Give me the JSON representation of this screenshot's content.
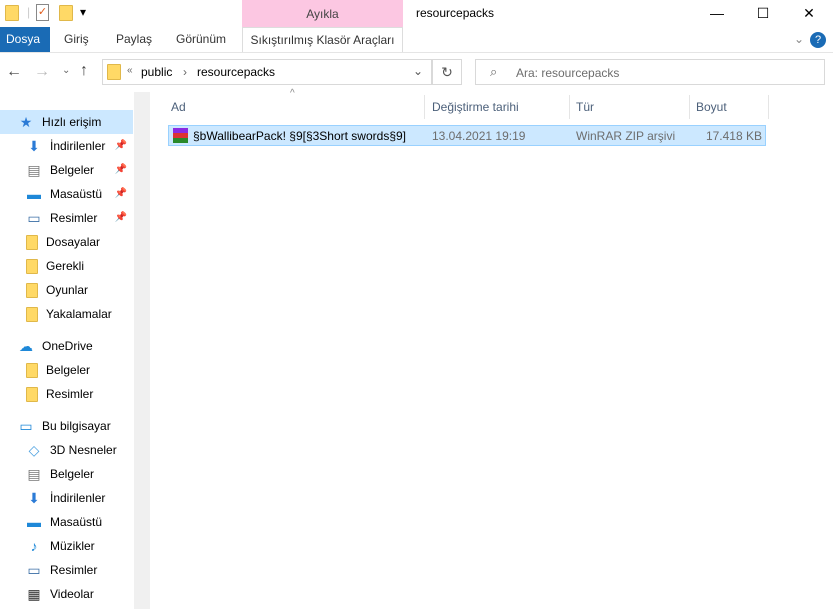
{
  "window": {
    "title": "resourcepacks",
    "context_tab": "Ayıkla",
    "minimize": "—",
    "maximize": "☐",
    "close": "✕"
  },
  "ribbon": {
    "tabs": [
      "Dosya",
      "Giriş",
      "Paylaş",
      "Görünüm",
      "Sıkıştırılmış Klasör Araçları"
    ],
    "help": "?",
    "collapse": "⌄"
  },
  "address": {
    "prefix": "«",
    "crumbs": [
      "public",
      "resourcepacks"
    ],
    "sep": "›"
  },
  "search": {
    "placeholder": "Ara: resourcepacks"
  },
  "columns": [
    "Ad",
    "Değiştirme tarihi",
    "Tür",
    "Boyut"
  ],
  "files": [
    {
      "name": "§bWallibearPack!  §9[§3Short swords§9]",
      "date": "13.04.2021 19:19",
      "type": "WinRAR ZIP arşivi",
      "size": "17.418 KB"
    }
  ],
  "nav": [
    {
      "label": "Hızlı erişim",
      "icon": "star",
      "top": true
    },
    {
      "label": "İndirilenler",
      "icon": "download",
      "pin": true
    },
    {
      "label": "Belgeler",
      "icon": "document",
      "pin": true
    },
    {
      "label": "Masaüstü",
      "icon": "desktop",
      "pin": true
    },
    {
      "label": "Resimler",
      "icon": "pictures",
      "pin": true
    },
    {
      "label": "Dosayalar",
      "icon": "folder"
    },
    {
      "label": "Gerekli",
      "icon": "folder"
    },
    {
      "label": "Oyunlar",
      "icon": "folder"
    },
    {
      "label": "Yakalamalar",
      "icon": "folder"
    },
    {
      "label": "OneDrive",
      "icon": "cloud",
      "top": true
    },
    {
      "label": "Belgeler",
      "icon": "folder"
    },
    {
      "label": "Resimler",
      "icon": "folder"
    },
    {
      "label": "Bu bilgisayar",
      "icon": "pc",
      "top": true
    },
    {
      "label": "3D Nesneler",
      "icon": "cube"
    },
    {
      "label": "Belgeler",
      "icon": "document"
    },
    {
      "label": "İndirilenler",
      "icon": "download"
    },
    {
      "label": "Masaüstü",
      "icon": "desktop"
    },
    {
      "label": "Müzikler",
      "icon": "music"
    },
    {
      "label": "Resimler",
      "icon": "pictures"
    },
    {
      "label": "Videolar",
      "icon": "video"
    }
  ]
}
